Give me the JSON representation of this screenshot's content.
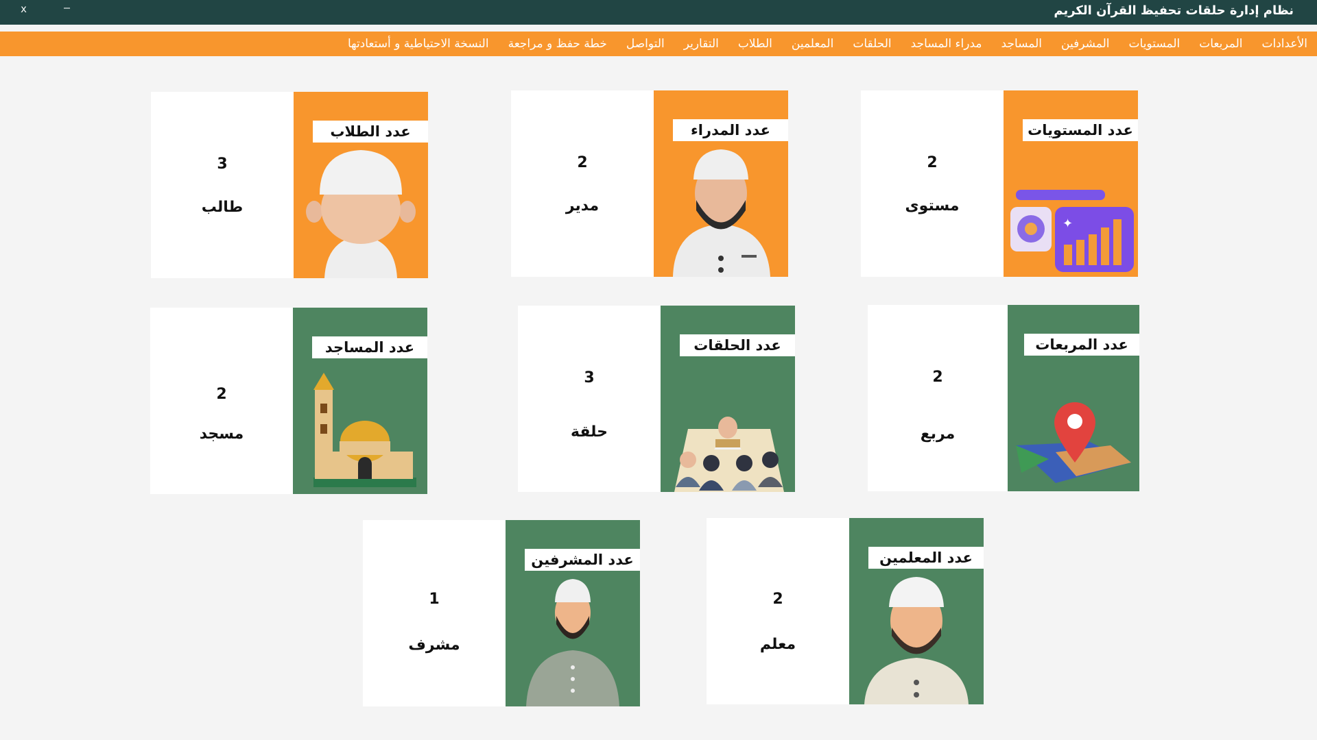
{
  "window": {
    "title": "نظام إدارة حلقات تحفيظ القرآن الكريم",
    "close_label": "x",
    "minimize_label": "—"
  },
  "menu": [
    {
      "label": "الأعدادات"
    },
    {
      "label": "المربعات"
    },
    {
      "label": "المستويات"
    },
    {
      "label": "المشرفين"
    },
    {
      "label": "المساجد"
    },
    {
      "label": "مدراء المساجد"
    },
    {
      "label": "الحلقات"
    },
    {
      "label": "المعلمين"
    },
    {
      "label": "الطلاب"
    },
    {
      "label": "التقارير"
    },
    {
      "label": "التواصل"
    },
    {
      "label": "خطة حفظ و مراجعة"
    },
    {
      "label": "النسخة الاحتياطية و أستعادتها"
    }
  ],
  "cards": {
    "levels": {
      "title": "عدد المستويات",
      "count": "2",
      "unit": "مستوى",
      "color": "#f8962d",
      "icon": "chart-dashboard-icon"
    },
    "managers": {
      "title": "عدد  المدراء",
      "count": "2",
      "unit": "مدير",
      "color": "#f8962d",
      "icon": "manager-avatar-icon"
    },
    "students": {
      "title": "عدد الطلاب",
      "count": "3",
      "unit": "طالب",
      "color": "#f8962d",
      "icon": "student-avatar-icon"
    },
    "squares": {
      "title": "عدد المربعات",
      "count": "2",
      "unit": "مربع",
      "color": "#4e8560",
      "icon": "map-pin-icon"
    },
    "circles": {
      "title": "عدد الحلقات",
      "count": "3",
      "unit": "حلقة",
      "color": "#4e8560",
      "icon": "study-circle-icon"
    },
    "mosques": {
      "title": "عدد المساجد",
      "count": "2",
      "unit": "مسجد",
      "color": "#4e8560",
      "icon": "mosque-icon"
    },
    "teachers": {
      "title": "عدد المعلمين",
      "count": "2",
      "unit": "معلم",
      "color": "#4e8560",
      "icon": "teacher-avatar-icon"
    },
    "supervisors": {
      "title": "عدد المشرفين",
      "count": "1",
      "unit": "مشرف",
      "color": "#4e8560",
      "icon": "supervisor-avatar-icon"
    }
  }
}
